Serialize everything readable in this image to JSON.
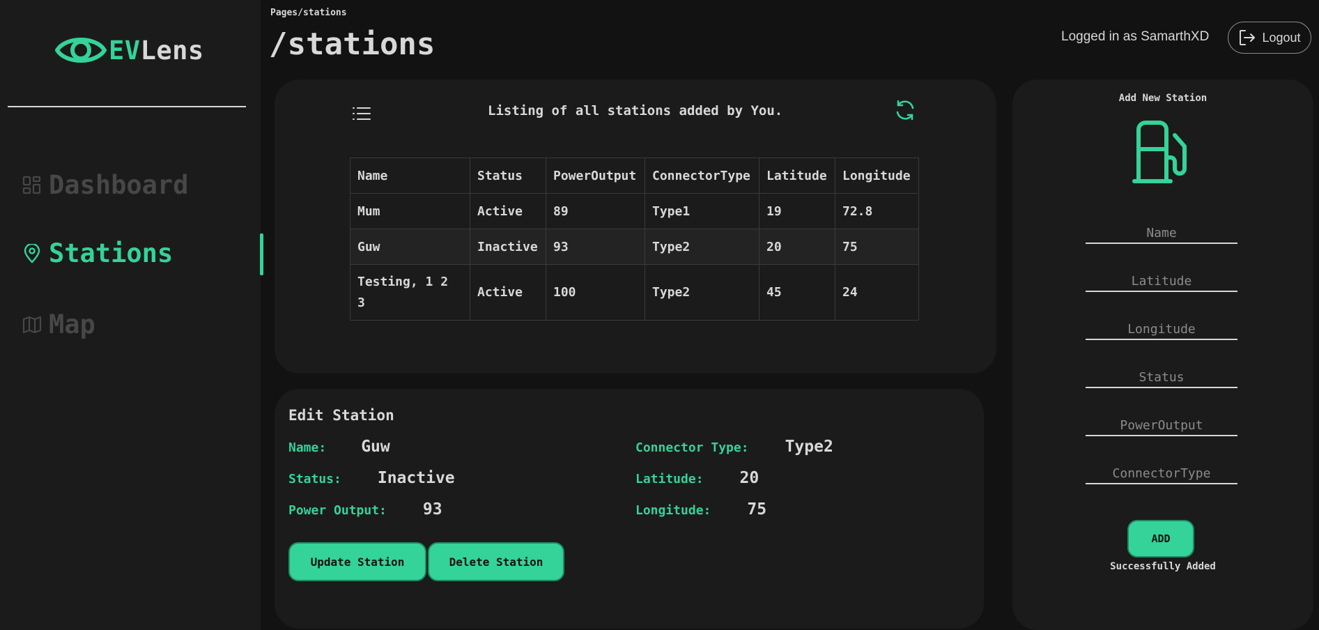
{
  "sidebar": {
    "brand_ev": "EV",
    "brand_lens": "Lens",
    "items": [
      {
        "label": "Dashboard",
        "icon": "dashboard-icon"
      },
      {
        "label": "Stations",
        "icon": "map-pin-icon"
      },
      {
        "label": "Map",
        "icon": "map-icon"
      }
    ]
  },
  "header": {
    "breadcrumb": "Pages/stations",
    "title": "/stations",
    "logged_in": "Logged in as SamarthXD",
    "logout_label": "Logout"
  },
  "listing": {
    "heading": "Listing of all stations added by You.",
    "columns": [
      "Name",
      "Status",
      "PowerOutput",
      "ConnectorType",
      "Latitude",
      "Longitude"
    ],
    "rows": [
      [
        "Mum",
        "Active",
        "89",
        "Type1",
        "19",
        "72.8"
      ],
      [
        "Guw",
        "Inactive",
        "93",
        "Type2",
        "20",
        "75"
      ],
      [
        "Testing, 1 2 3",
        "Active",
        "100",
        "Type2",
        "45",
        "24"
      ]
    ]
  },
  "edit": {
    "title": "Edit Station",
    "name_label": "Name:",
    "name_value": "Guw",
    "status_label": "Status:",
    "status_value": "Inactive",
    "power_label": "Power Output:",
    "power_value": "93",
    "connector_label": "Connector Type:",
    "connector_value": "Type2",
    "latitude_label": "Latitude:",
    "latitude_value": "20",
    "longitude_label": "Longitude:",
    "longitude_value": "75",
    "update_label": "Update Station",
    "delete_label": "Delete Station"
  },
  "add": {
    "title": "Add New Station",
    "icon": "fuel-pump-icon",
    "placeholders": {
      "name": "Name",
      "latitude": "Latitude",
      "longitude": "Longitude",
      "status": "Status",
      "power": "PowerOutput",
      "connector": "ConnectorType"
    },
    "add_label": "ADD",
    "success": "Successfully Added"
  },
  "colors": {
    "accent": "#34d399",
    "background": "#121212",
    "card": "#1b1b1b",
    "muted": "#474747",
    "text": "#d8d8d8"
  }
}
